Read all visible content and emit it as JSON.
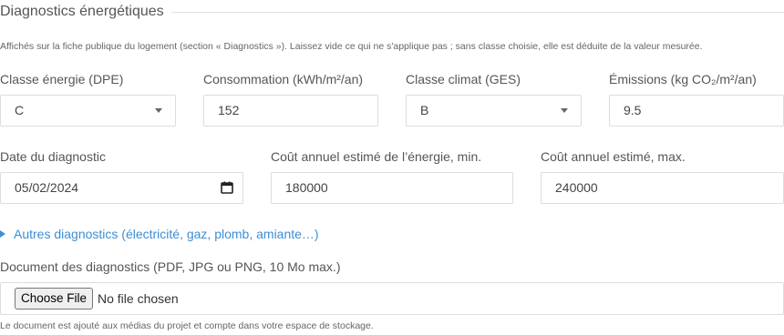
{
  "section": {
    "title": "Diagnostics énergétiques",
    "help_top": "Affichés sur la fiche publique du logement (section « Diagnostics »). Laissez vide ce qui ne s'applique pas ; sans classe choisie, elle est déduite de la valeur mesurée."
  },
  "row1": {
    "dpe_label": "Classe énergie (DPE)",
    "dpe_value": "C",
    "consumption_label": "Consommation (kWh/m²/an)",
    "consumption_value": "152",
    "ges_label": "Classe climat (GES)",
    "ges_value": "B",
    "emissions_label": "Émissions (kg CO₂/m²/an)",
    "emissions_value": "9.5"
  },
  "row2": {
    "date_label": "Date du diagnostic",
    "date_value": "05/02/2024",
    "cost_min_label": "Coût annuel estimé de l’énergie, min.",
    "cost_min_value": "180000",
    "cost_max_label": "Coût annuel estimé, max.",
    "cost_max_value": "240000"
  },
  "other_diagnostics": {
    "label": "Autres diagnostics (électricité, gaz, plomb, amiante…)"
  },
  "document": {
    "label": "Document des diagnostics (PDF, JPG ou PNG, 10 Mo max.)",
    "button_label": "Choose File",
    "status": "No file chosen",
    "help": "Le document est ajouté aux médias du projet et compte dans votre espace de stockage."
  },
  "colors": {
    "link": "#3b8ed8",
    "border": "#dddddd",
    "text": "#555555"
  },
  "icons": {
    "select": "chevron-down-icon",
    "date": "calendar-icon",
    "disclosure": "triangle-right-icon"
  }
}
